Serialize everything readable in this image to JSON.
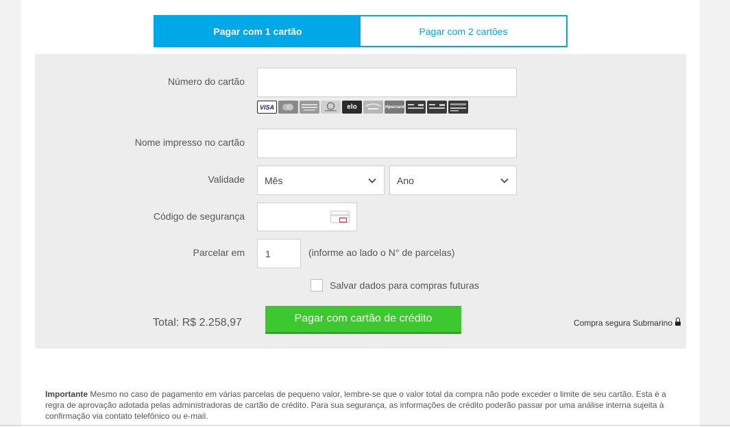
{
  "tabs": [
    {
      "label": "Pagar com 1 cartão",
      "active": true
    },
    {
      "label": "Pagar com 2 cartões",
      "active": false
    }
  ],
  "form": {
    "card_number_label": "Número do cartão",
    "card_number_value": "",
    "card_brands": [
      {
        "name": "VISA",
        "icon": "visa-icon"
      },
      {
        "name": "MasterCard",
        "icon": "mastercard-icon"
      },
      {
        "name": "American Express",
        "icon": "amex-icon"
      },
      {
        "name": "DinersClub",
        "icon": "diners-icon"
      },
      {
        "name": "elo",
        "icon": "elo-icon"
      },
      {
        "name": "Aura",
        "icon": "aura-icon"
      },
      {
        "name": "Hipercard",
        "icon": "hipercard-icon"
      },
      {
        "name": "",
        "icon": "store-card-icon"
      },
      {
        "name": "",
        "icon": "store-card-icon"
      },
      {
        "name": "",
        "icon": "store-card-icon"
      }
    ],
    "name_label": "Nome impresso no cartão",
    "name_value": "",
    "validity_label": "Validade",
    "month_selected": "Mês",
    "year_selected": "Ano",
    "security_label": "Código de segurança",
    "security_value": "",
    "installments_label": "Parcelar em",
    "installments_value": "1",
    "installments_hint": "(informe ao lado o N° de parcelas)",
    "save_data_label": "Salvar dados para compras futuras",
    "save_data_checked": false,
    "total_text": "Total: R$ 2.258,97",
    "pay_button": "Pagar com cartão de crédito",
    "secure_text": "Compra segura Submarino"
  },
  "notice": {
    "title": "Importante",
    "text": " Mesmo no caso de pagamento em várias parcelas de pequeno valor, lembre-se que o valor total da compra não pode exceder o limite de seu cartão. Esta é a regra de aprovação adotada pelas administradoras de cartão de crédito. Para sua segurança, as informações de crédito poderão passar por uma análise interna sujeita à confirmação via contato telefônico ou e-mail."
  },
  "colors": {
    "accent": "#00a8e8",
    "pay_button": "#3cc82e",
    "panel": "#ededed"
  }
}
